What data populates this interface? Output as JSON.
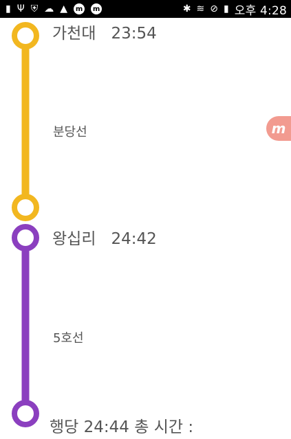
{
  "status_bar": {
    "left_icons": [
      "message-icon",
      "usb-icon",
      "shield-icon",
      "cloud-icon",
      "warning-icon",
      "app-badge-icon",
      "app-badge-icon"
    ],
    "right_icons": [
      "bluetooth-icon",
      "wifi-icon",
      "do-not-disturb-icon",
      "battery-icon"
    ],
    "time": "오후 4:28"
  },
  "route": {
    "stops": [
      {
        "name": "가천대",
        "time": "23:54"
      },
      {
        "name": "왕십리",
        "time": "24:42"
      }
    ],
    "segments": [
      {
        "line": "분당선",
        "color": "#f2b720"
      },
      {
        "line": "5호선",
        "color": "#8b3fbf"
      }
    ],
    "final": {
      "text": "행당  24:44   총 시간 :"
    }
  },
  "floating_button": {
    "label": "m"
  }
}
